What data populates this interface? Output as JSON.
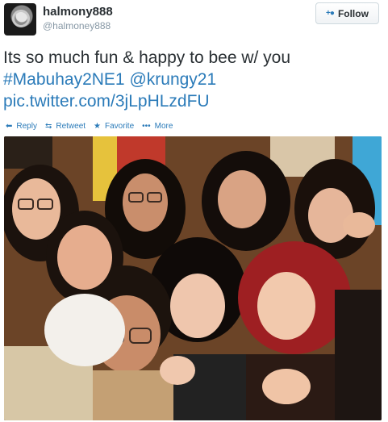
{
  "user": {
    "name": "halmony888",
    "handle": "@halmoney888"
  },
  "follow_button": {
    "label": "Follow",
    "icon": "add-user-icon"
  },
  "tweet": {
    "text_line": "Its so much fun & happy to bee w/ you",
    "hashtag": "#Mabuhay2NE1",
    "mention": "@krungy21",
    "pic_link": "pic.twitter.com/3jLpHLzdFU"
  },
  "actions": [
    {
      "label": "Reply",
      "icon": "reply-icon"
    },
    {
      "label": "Retweet",
      "icon": "retweet-icon"
    },
    {
      "label": "Favorite",
      "icon": "star-icon"
    },
    {
      "label": "More",
      "icon": "more-dots-icon"
    }
  ],
  "colors": {
    "link": "#2b7bb9",
    "text": "#292f33",
    "muted": "#8899a6"
  },
  "photo": {
    "description_icon": "group-selfie-photo"
  }
}
